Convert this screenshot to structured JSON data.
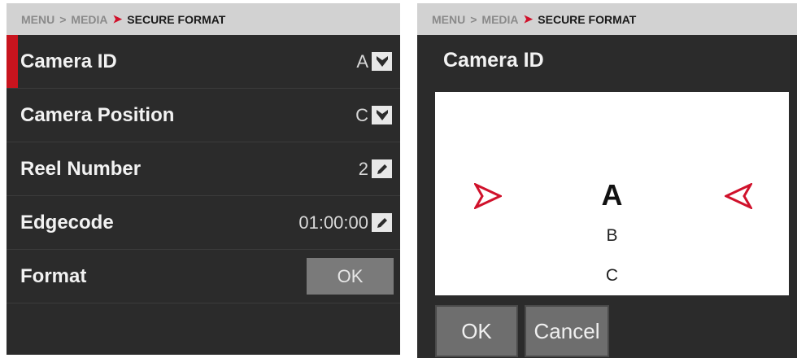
{
  "breadcrumb": {
    "item1": "MENU",
    "sep1": ">",
    "item2": "MEDIA",
    "sep2": "➤",
    "current": "SECURE FORMAT"
  },
  "menu": {
    "rows": [
      {
        "label": "Camera ID",
        "value": "A",
        "icon": "dropdown-arrow-icon",
        "selected": true
      },
      {
        "label": "Camera Position",
        "value": "C",
        "icon": "dropdown-arrow-icon"
      },
      {
        "label": "Reel Number",
        "value": "2",
        "icon": "pencil-icon"
      },
      {
        "label": "Edgecode",
        "value": "01:00:00",
        "icon": "pencil-icon"
      },
      {
        "label": "Format",
        "button": "OK"
      }
    ]
  },
  "dialog": {
    "title": "Camera ID",
    "options": [
      "A",
      "B",
      "C"
    ],
    "selected": "A",
    "ok_label": "OK",
    "cancel_label": "Cancel"
  },
  "colors": {
    "accent": "#c8141e",
    "panel": "#2b2b2b",
    "header": "#d2d2d2"
  }
}
